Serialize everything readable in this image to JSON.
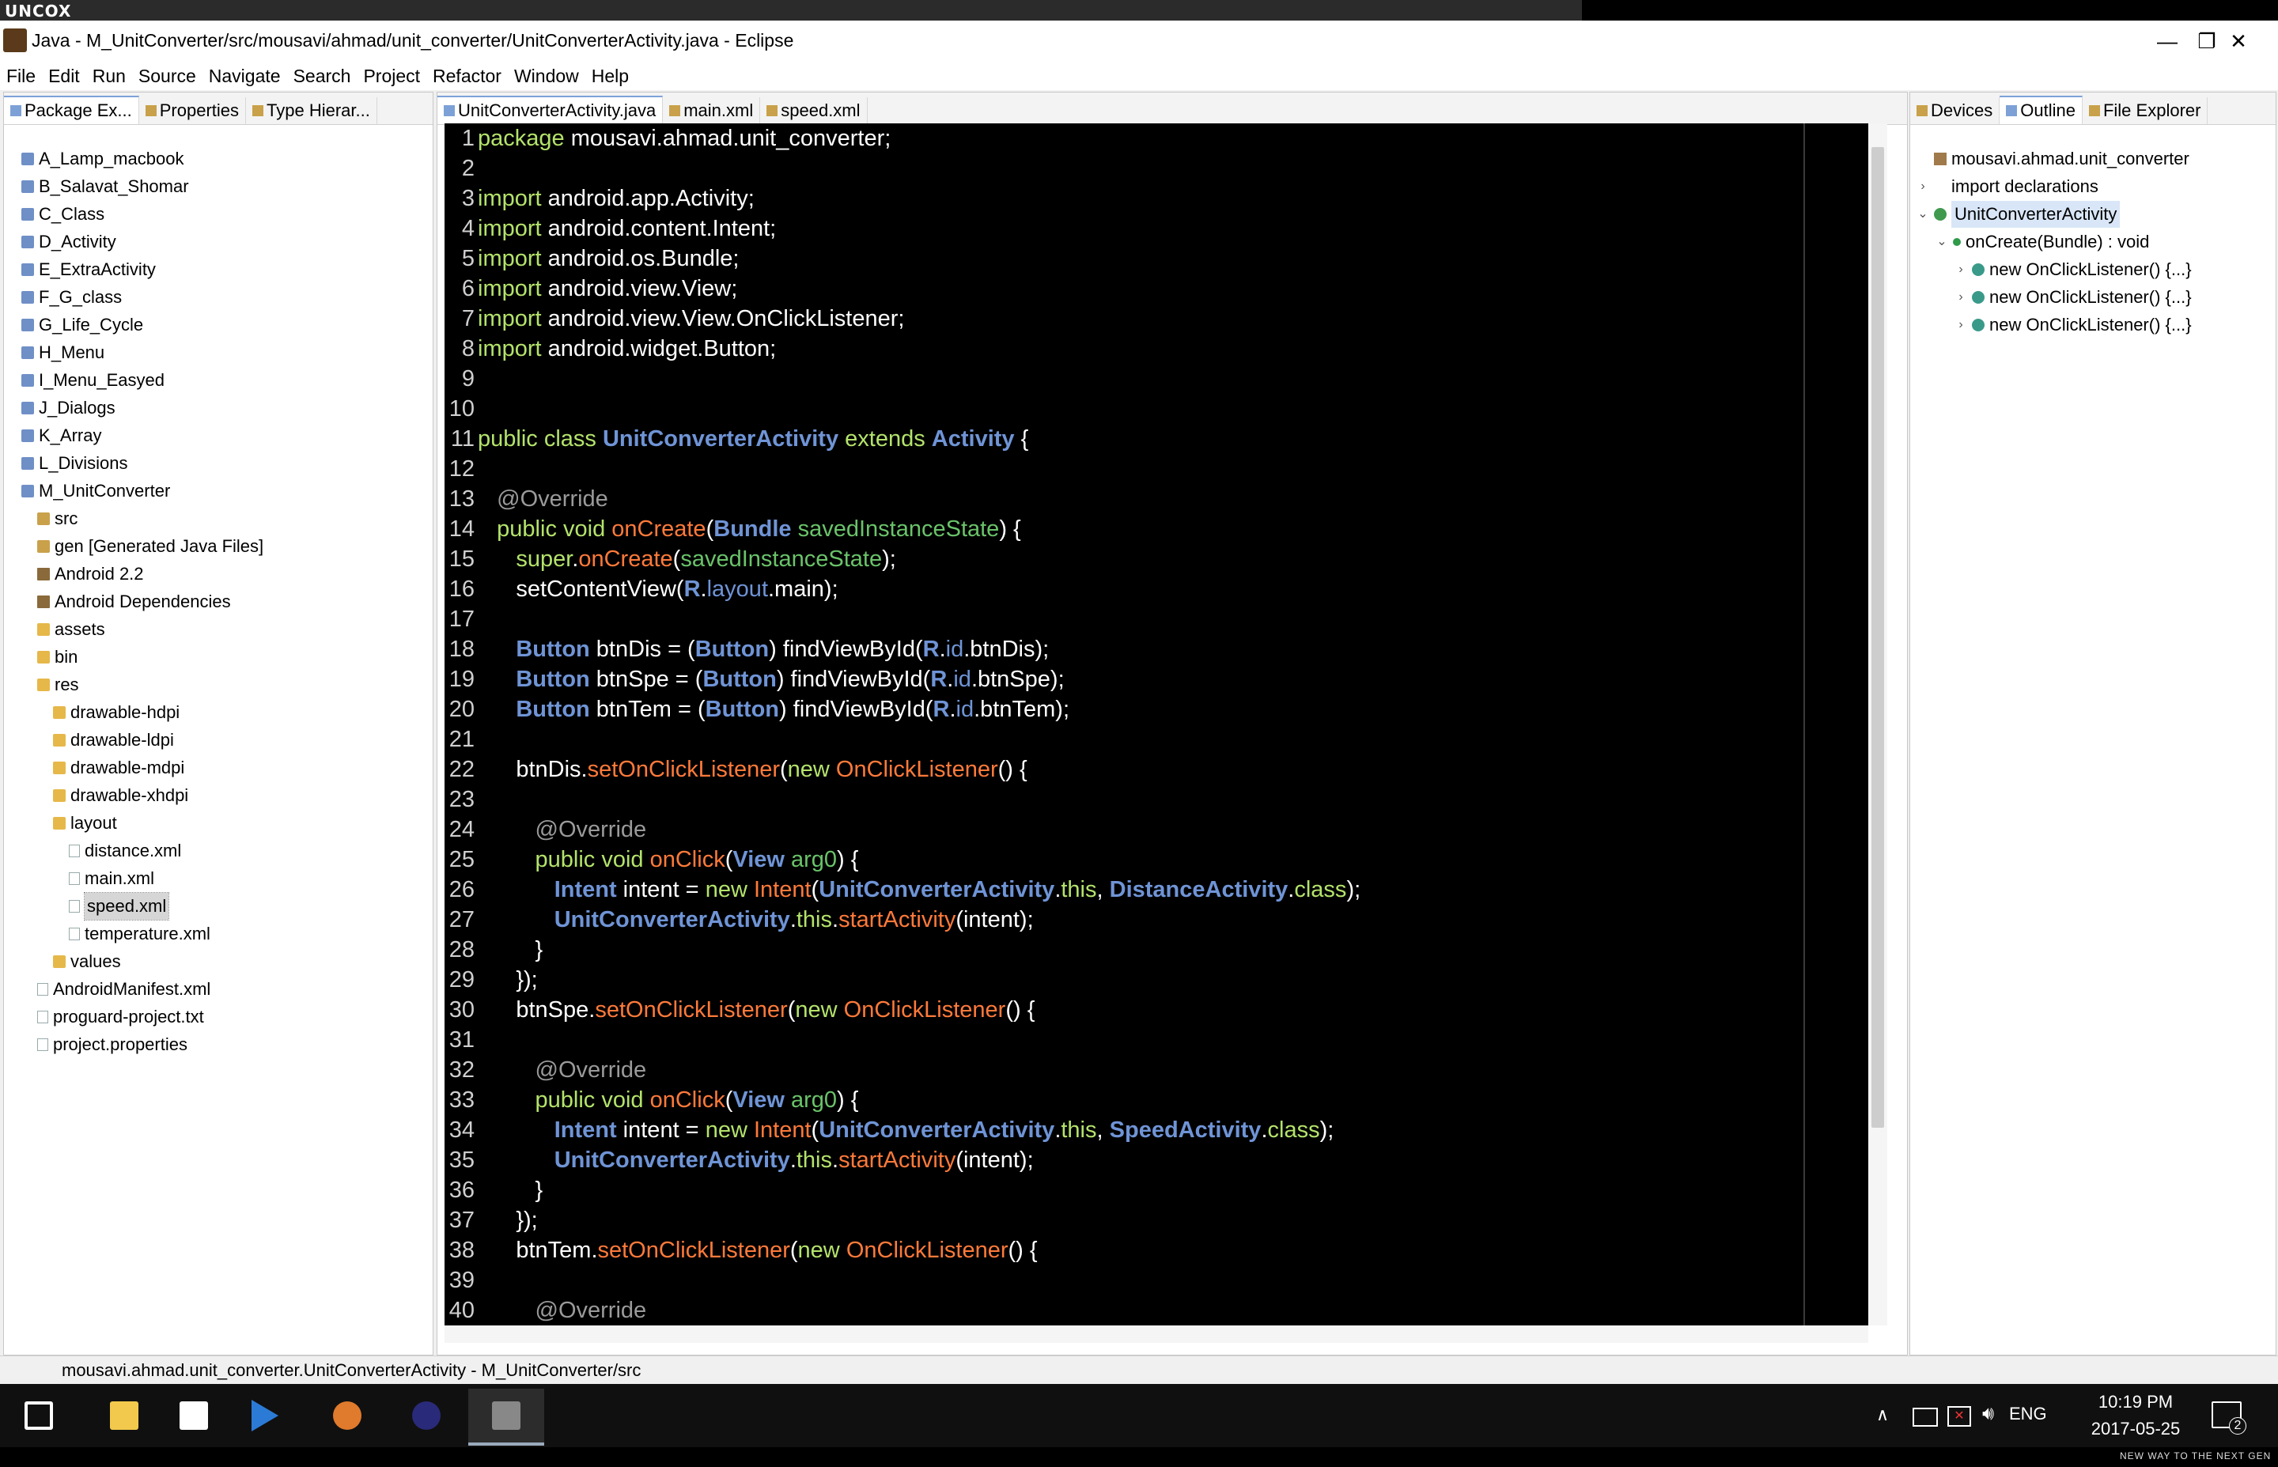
{
  "banner": {
    "logo": "UNCOX"
  },
  "window": {
    "title": "Java - M_UnitConverter/src/mousavi/ahmad/unit_converter/UnitConverterActivity.java - Eclipse",
    "minimize_glyph": "—",
    "restore_glyph": "❐",
    "close_glyph": "✕"
  },
  "menubar": [
    "File",
    "Edit",
    "Run",
    "Source",
    "Navigate",
    "Search",
    "Project",
    "Refactor",
    "Window",
    "Help"
  ],
  "left_panel": {
    "tabs": [
      "Package Ex...",
      "Properties",
      "Type Hierar..."
    ],
    "tree": [
      {
        "label": "A_Lamp_macbook",
        "icon": "project-icon",
        "indent": 0
      },
      {
        "label": "B_Salavat_Shomar",
        "icon": "project-icon",
        "indent": 0
      },
      {
        "label": "C_Class",
        "icon": "project-icon",
        "indent": 0
      },
      {
        "label": "D_Activity",
        "icon": "project-icon",
        "indent": 0
      },
      {
        "label": "E_ExtraActivity",
        "icon": "project-icon",
        "indent": 0
      },
      {
        "label": "F_G_class",
        "icon": "project-icon",
        "indent": 0
      },
      {
        "label": "G_Life_Cycle",
        "icon": "project-icon",
        "indent": 0
      },
      {
        "label": "H_Menu",
        "icon": "project-icon",
        "indent": 0
      },
      {
        "label": "I_Menu_Easyed",
        "icon": "project-icon",
        "indent": 0
      },
      {
        "label": "J_Dialogs",
        "icon": "project-icon",
        "indent": 0
      },
      {
        "label": "K_Array",
        "icon": "project-icon",
        "indent": 0
      },
      {
        "label": "L_Divisions",
        "icon": "project-icon",
        "indent": 0
      },
      {
        "label": "M_UnitConverter",
        "icon": "project-icon",
        "indent": 0
      },
      {
        "label": "src",
        "icon": "source-folder-icon",
        "indent": 1
      },
      {
        "label": "gen [Generated Java Files]",
        "icon": "source-folder-icon",
        "indent": 1
      },
      {
        "label": "Android 2.2",
        "icon": "library-icon",
        "indent": 1
      },
      {
        "label": "Android Dependencies",
        "icon": "library-icon",
        "indent": 1
      },
      {
        "label": "assets",
        "icon": "folder-icon",
        "indent": 1
      },
      {
        "label": "bin",
        "icon": "folder-icon",
        "indent": 1
      },
      {
        "label": "res",
        "icon": "folder-icon",
        "indent": 1
      },
      {
        "label": "drawable-hdpi",
        "icon": "folder-icon",
        "indent": 2
      },
      {
        "label": "drawable-ldpi",
        "icon": "folder-icon",
        "indent": 2
      },
      {
        "label": "drawable-mdpi",
        "icon": "folder-icon",
        "indent": 2
      },
      {
        "label": "drawable-xhdpi",
        "icon": "folder-icon",
        "indent": 2
      },
      {
        "label": "layout",
        "icon": "folder-icon",
        "indent": 2
      },
      {
        "label": "distance.xml",
        "icon": "xml-file-icon",
        "indent": 3
      },
      {
        "label": "main.xml",
        "icon": "xml-file-icon",
        "indent": 3
      },
      {
        "label": "speed.xml",
        "icon": "xml-file-icon",
        "indent": 3,
        "selected": true
      },
      {
        "label": "temperature.xml",
        "icon": "xml-file-icon",
        "indent": 3
      },
      {
        "label": "values",
        "icon": "folder-icon",
        "indent": 2
      },
      {
        "label": "AndroidManifest.xml",
        "icon": "xml-file-icon",
        "indent": 1
      },
      {
        "label": "proguard-project.txt",
        "icon": "text-file-icon",
        "indent": 1
      },
      {
        "label": "project.properties",
        "icon": "text-file-icon",
        "indent": 1
      }
    ]
  },
  "editor": {
    "tabs": [
      "UnitConverterActivity.java",
      "main.xml",
      "speed.xml"
    ],
    "lines": [
      {
        "n": "1",
        "parts": [
          [
            "kw",
            "package"
          ],
          [
            "code",
            " mousavi.ahmad.unit_converter;"
          ]
        ]
      },
      {
        "n": "2",
        "parts": []
      },
      {
        "n": "3",
        "parts": [
          [
            "kw",
            "import"
          ],
          [
            "code",
            " android.app.Activity;"
          ]
        ]
      },
      {
        "n": "4",
        "parts": [
          [
            "kw",
            "import"
          ],
          [
            "code",
            " android.content.Intent;"
          ]
        ]
      },
      {
        "n": "5",
        "parts": [
          [
            "kw",
            "import"
          ],
          [
            "code",
            " android.os.Bundle;"
          ]
        ]
      },
      {
        "n": "6",
        "parts": [
          [
            "kw",
            "import"
          ],
          [
            "code",
            " android.view.View;"
          ]
        ]
      },
      {
        "n": "7",
        "parts": [
          [
            "kw",
            "import"
          ],
          [
            "code",
            " android.view.View.OnClickListener;"
          ]
        ]
      },
      {
        "n": "8",
        "parts": [
          [
            "kw",
            "import"
          ],
          [
            "code",
            " android.widget.Button;"
          ]
        ]
      },
      {
        "n": "9",
        "parts": []
      },
      {
        "n": "10",
        "parts": []
      },
      {
        "n": "11",
        "parts": [
          [
            "kw",
            "public class "
          ],
          [
            "ty",
            "UnitConverterActivity"
          ],
          [
            "kw",
            " extends "
          ],
          [
            "ty",
            "Activity"
          ],
          [
            "code",
            " {"
          ]
        ]
      },
      {
        "n": "12",
        "parts": []
      },
      {
        "n": "13",
        "parts": [
          [
            "code",
            "   "
          ],
          [
            "an",
            "@Override"
          ]
        ]
      },
      {
        "n": "14",
        "parts": [
          [
            "code",
            "   "
          ],
          [
            "kw",
            "public void "
          ],
          [
            "mt",
            "onCreate"
          ],
          [
            "code",
            "("
          ],
          [
            "ty",
            "Bundle"
          ],
          [
            "pm",
            " savedInstanceState"
          ],
          [
            "code",
            ") {"
          ]
        ]
      },
      {
        "n": "15",
        "parts": [
          [
            "code",
            "      "
          ],
          [
            "kw",
            "super"
          ],
          [
            "code",
            "."
          ],
          [
            "mt",
            "onCreate"
          ],
          [
            "code",
            "("
          ],
          [
            "pm",
            "savedInstanceState"
          ],
          [
            "code",
            ");"
          ]
        ]
      },
      {
        "n": "16",
        "parts": [
          [
            "code",
            "      setContentView("
          ],
          [
            "ty",
            "R"
          ],
          [
            "code",
            "."
          ],
          [
            "fd",
            "layout"
          ],
          [
            "code",
            ".main);"
          ]
        ]
      },
      {
        "n": "17",
        "parts": []
      },
      {
        "n": "18",
        "parts": [
          [
            "code",
            "      "
          ],
          [
            "ty",
            "Button"
          ],
          [
            "code",
            " btnDis = ("
          ],
          [
            "ty",
            "Button"
          ],
          [
            "code",
            ") findViewById("
          ],
          [
            "ty",
            "R"
          ],
          [
            "code",
            "."
          ],
          [
            "fd",
            "id"
          ],
          [
            "code",
            ".btnDis);"
          ]
        ]
      },
      {
        "n": "19",
        "parts": [
          [
            "code",
            "      "
          ],
          [
            "ty",
            "Button"
          ],
          [
            "code",
            " btnSpe = ("
          ],
          [
            "ty",
            "Button"
          ],
          [
            "code",
            ") findViewById("
          ],
          [
            "ty",
            "R"
          ],
          [
            "code",
            "."
          ],
          [
            "fd",
            "id"
          ],
          [
            "code",
            ".btnSpe);"
          ]
        ]
      },
      {
        "n": "20",
        "parts": [
          [
            "code",
            "      "
          ],
          [
            "ty",
            "Button"
          ],
          [
            "code",
            " btnTem = ("
          ],
          [
            "ty",
            "Button"
          ],
          [
            "code",
            ") findViewById("
          ],
          [
            "ty",
            "R"
          ],
          [
            "code",
            "."
          ],
          [
            "fd",
            "id"
          ],
          [
            "code",
            ".btnTem);"
          ]
        ]
      },
      {
        "n": "21",
        "parts": []
      },
      {
        "n": "22",
        "parts": [
          [
            "code",
            "      btnDis."
          ],
          [
            "mt",
            "setOnClickListener"
          ],
          [
            "code",
            "("
          ],
          [
            "kw",
            "new "
          ],
          [
            "mt",
            "OnClickListener"
          ],
          [
            "code",
            "() {"
          ]
        ]
      },
      {
        "n": "23",
        "parts": []
      },
      {
        "n": "24",
        "parts": [
          [
            "code",
            "         "
          ],
          [
            "an",
            "@Override"
          ]
        ]
      },
      {
        "n": "25",
        "parts": [
          [
            "code",
            "         "
          ],
          [
            "kw",
            "public void "
          ],
          [
            "mt",
            "onClick"
          ],
          [
            "code",
            "("
          ],
          [
            "ty",
            "View"
          ],
          [
            "pm",
            " arg0"
          ],
          [
            "code",
            ") {"
          ]
        ]
      },
      {
        "n": "26",
        "parts": [
          [
            "code",
            "            "
          ],
          [
            "ty",
            "Intent"
          ],
          [
            "code",
            " intent = "
          ],
          [
            "kw",
            "new "
          ],
          [
            "mt",
            "Intent"
          ],
          [
            "code",
            "("
          ],
          [
            "ty",
            "UnitConverterActivity"
          ],
          [
            "code",
            "."
          ],
          [
            "kw",
            "this"
          ],
          [
            "code",
            ", "
          ],
          [
            "ty",
            "DistanceActivity"
          ],
          [
            "code",
            "."
          ],
          [
            "kw",
            "class"
          ],
          [
            "code",
            ");"
          ]
        ]
      },
      {
        "n": "27",
        "parts": [
          [
            "code",
            "            "
          ],
          [
            "ty",
            "UnitConverterActivity"
          ],
          [
            "code",
            "."
          ],
          [
            "kw",
            "this"
          ],
          [
            "code",
            "."
          ],
          [
            "mt",
            "startActivity"
          ],
          [
            "code",
            "(intent);"
          ]
        ]
      },
      {
        "n": "28",
        "parts": [
          [
            "code",
            "         }"
          ]
        ]
      },
      {
        "n": "29",
        "parts": [
          [
            "code",
            "      });"
          ]
        ]
      },
      {
        "n": "30",
        "parts": [
          [
            "code",
            "      btnSpe."
          ],
          [
            "mt",
            "setOnClickListener"
          ],
          [
            "code",
            "("
          ],
          [
            "kw",
            "new "
          ],
          [
            "mt",
            "OnClickListener"
          ],
          [
            "code",
            "() {"
          ]
        ]
      },
      {
        "n": "31",
        "parts": []
      },
      {
        "n": "32",
        "parts": [
          [
            "code",
            "         "
          ],
          [
            "an",
            "@Override"
          ]
        ]
      },
      {
        "n": "33",
        "parts": [
          [
            "code",
            "         "
          ],
          [
            "kw",
            "public void "
          ],
          [
            "mt",
            "onClick"
          ],
          [
            "code",
            "("
          ],
          [
            "ty",
            "View"
          ],
          [
            "pm",
            " arg0"
          ],
          [
            "code",
            ") {"
          ]
        ]
      },
      {
        "n": "34",
        "parts": [
          [
            "code",
            "            "
          ],
          [
            "ty",
            "Intent"
          ],
          [
            "code",
            " intent = "
          ],
          [
            "kw",
            "new "
          ],
          [
            "mt",
            "Intent"
          ],
          [
            "code",
            "("
          ],
          [
            "ty",
            "UnitConverterActivity"
          ],
          [
            "code",
            "."
          ],
          [
            "kw",
            "this"
          ],
          [
            "code",
            ", "
          ],
          [
            "ty",
            "SpeedActivity"
          ],
          [
            "code",
            "."
          ],
          [
            "kw",
            "class"
          ],
          [
            "code",
            ");"
          ]
        ]
      },
      {
        "n": "35",
        "parts": [
          [
            "code",
            "            "
          ],
          [
            "ty",
            "UnitConverterActivity"
          ],
          [
            "code",
            "."
          ],
          [
            "kw",
            "this"
          ],
          [
            "code",
            "."
          ],
          [
            "mt",
            "startActivity"
          ],
          [
            "code",
            "(intent);"
          ]
        ]
      },
      {
        "n": "36",
        "parts": [
          [
            "code",
            "         }"
          ]
        ]
      },
      {
        "n": "37",
        "parts": [
          [
            "code",
            "      });"
          ]
        ]
      },
      {
        "n": "38",
        "parts": [
          [
            "code",
            "      btnTem."
          ],
          [
            "mt",
            "setOnClickListener"
          ],
          [
            "code",
            "("
          ],
          [
            "kw",
            "new "
          ],
          [
            "mt",
            "OnClickListener"
          ],
          [
            "code",
            "() {"
          ]
        ]
      },
      {
        "n": "39",
        "parts": []
      },
      {
        "n": "40",
        "parts": [
          [
            "code",
            "         "
          ],
          [
            "an",
            "@Override"
          ]
        ]
      }
    ]
  },
  "right_panel": {
    "tabs": [
      "Devices",
      "Outline",
      "File Explorer"
    ],
    "tree": [
      {
        "label": "mousavi.ahmad.unit_converter",
        "icon": "package-icon",
        "indent": 0,
        "chevron": ""
      },
      {
        "label": "import declarations",
        "icon": "",
        "indent": 0,
        "chevron": "›"
      },
      {
        "label": "UnitConverterActivity",
        "icon": "class-icon",
        "indent": 0,
        "chevron": "⌄",
        "selected": true
      },
      {
        "label": "onCreate(Bundle) : void",
        "icon": "method-icon",
        "indent": 1,
        "chevron": "⌄"
      },
      {
        "label": "new OnClickListener() {...}",
        "icon": "anonymous-class-icon",
        "indent": 2,
        "chevron": "›"
      },
      {
        "label": "new OnClickListener() {...}",
        "icon": "anonymous-class-icon",
        "indent": 2,
        "chevron": "›"
      },
      {
        "label": "new OnClickListener() {...}",
        "icon": "anonymous-class-icon",
        "indent": 2,
        "chevron": "›"
      }
    ]
  },
  "statusbar": {
    "text": "mousavi.ahmad.unit_converter.UnitConverterActivity - M_UnitConverter/src"
  },
  "taskbar": {
    "apps": [
      "windows-start-icon",
      "file-explorer-icon",
      "calculator-icon",
      "media-player-icon",
      "photo-viewer-icon",
      "eclipse-icon",
      "settings-app-icon"
    ],
    "language": "ENG",
    "time": "10:19 PM",
    "date": "2017-05-25",
    "notification_count": "2"
  },
  "bottom_strip": {
    "slogan": "NEW WAY TO THE NEXT GEN"
  },
  "colors": {
    "editor_bg": "#000000",
    "keyword": "#b4e36b",
    "type": "#6f94d6",
    "method": "#ff7a3a",
    "annotation": "#9a9a9a",
    "param": "#6ac36a",
    "selection": "#d9e6f7"
  }
}
